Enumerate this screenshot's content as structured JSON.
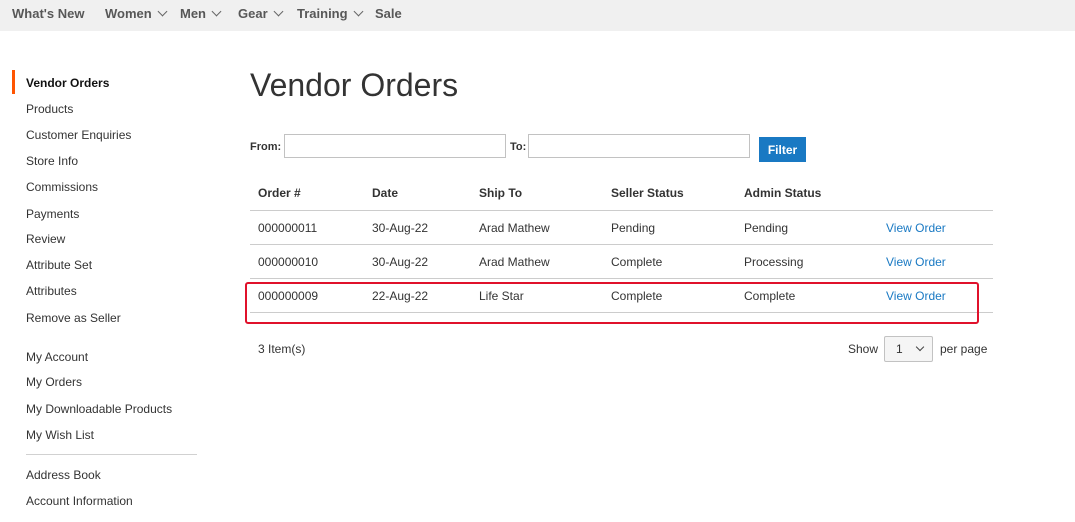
{
  "nav": {
    "items": [
      {
        "label": "What's New",
        "has_dropdown": false
      },
      {
        "label": "Women",
        "has_dropdown": true
      },
      {
        "label": "Men",
        "has_dropdown": true
      },
      {
        "label": "Gear",
        "has_dropdown": true
      },
      {
        "label": "Training",
        "has_dropdown": true
      },
      {
        "label": "Sale",
        "has_dropdown": false
      }
    ]
  },
  "sidebar": {
    "active_color": "#ff5501",
    "groups": [
      [
        {
          "label": "Vendor Orders",
          "active": true
        },
        {
          "label": "Products"
        },
        {
          "label": "Customer Enquiries"
        },
        {
          "label": "Store Info"
        },
        {
          "label": "Commissions"
        },
        {
          "label": "Payments"
        },
        {
          "label": "Review"
        },
        {
          "label": "Attribute Set"
        },
        {
          "label": "Attributes"
        },
        {
          "label": "Remove as Seller"
        }
      ],
      [
        {
          "label": "My Account"
        },
        {
          "label": "My Orders"
        },
        {
          "label": "My Downloadable Products"
        },
        {
          "label": "My Wish List"
        }
      ],
      [
        {
          "label": "Address Book"
        },
        {
          "label": "Account Information"
        }
      ]
    ]
  },
  "main": {
    "title": "Vendor Orders",
    "filter": {
      "from_label": "From:",
      "from_value": "",
      "to_label": "To:",
      "to_value": "",
      "button_label": "Filter",
      "button_color": "#1979c3"
    },
    "table": {
      "headers": [
        "Order #",
        "Date",
        "Ship To",
        "Seller Status",
        "Admin Status"
      ],
      "rows": [
        {
          "order": "000000011",
          "date": "30-Aug-22",
          "ship_to": "Arad Mathew",
          "seller_status": "Pending",
          "admin_status": "Pending",
          "action": "View Order"
        },
        {
          "order": "000000010",
          "date": "30-Aug-22",
          "ship_to": "Arad Mathew",
          "seller_status": "Complete",
          "admin_status": "Processing",
          "action": "View Order"
        },
        {
          "order": "000000009",
          "date": "22-Aug-22",
          "ship_to": "Life Star",
          "seller_status": "Complete",
          "admin_status": "Complete",
          "action": "View Order",
          "highlighted": true
        }
      ],
      "highlight_color": "#e0112b"
    },
    "pager": {
      "items_count": "3 Item(s)",
      "show_label": "Show",
      "limit_value": "1",
      "per_page_label": "per page"
    }
  }
}
